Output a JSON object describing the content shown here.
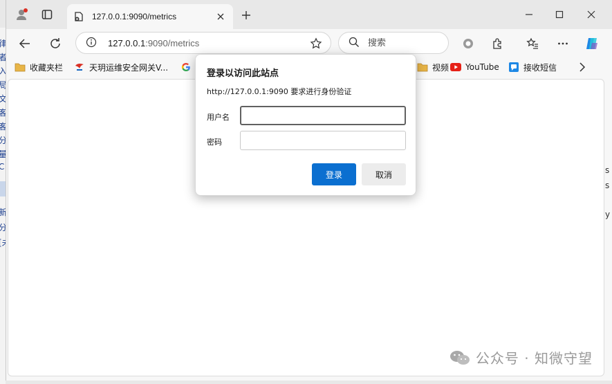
{
  "tab": {
    "title": "127.0.0.1:9090/metrics",
    "favicon": "page-error-icon"
  },
  "address": {
    "host": "127.0.0.1",
    "path": ":9090/metrics"
  },
  "search": {
    "placeholder": "搜索"
  },
  "bookmarks": [
    {
      "label": "收藏夹栏",
      "icon": "folder-icon"
    },
    {
      "label": "天玥运维安全网关V...",
      "icon": "site-favicon"
    },
    {
      "label": "",
      "icon": "google-icon"
    },
    {
      "label": "视频",
      "icon": "folder-icon"
    },
    {
      "label": "YouTube",
      "icon": "youtube-icon"
    },
    {
      "label": "接收短信",
      "icon": "sms-icon"
    }
  ],
  "dialog": {
    "title": "登录以访问此站点",
    "subtitle": "http://127.0.0.1:9090 要求进行身份验证",
    "username_label": "用户名",
    "username_value": "",
    "password_label": "密码",
    "password_value": "",
    "login_label": "登录",
    "cancel_label": "取消"
  },
  "watermark": {
    "text": "公众号 · 知微守望"
  },
  "background": {
    "left_chars": [
      "律",
      "者",
      "入",
      "局",
      "文",
      "客",
      "客",
      "分",
      "量",
      "C",
      "新",
      "分",
      "[未"
    ],
    "right_chars": [
      "s",
      "s",
      "y"
    ]
  },
  "colors": {
    "accent": "#0b6fd0",
    "youtube": "#e62117",
    "folder": "#e8b547"
  }
}
